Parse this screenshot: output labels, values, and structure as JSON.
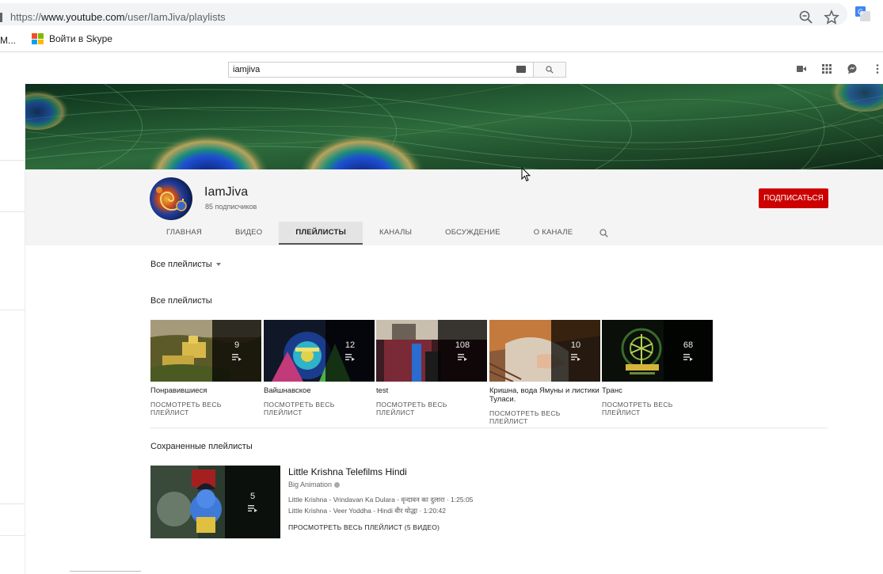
{
  "browser": {
    "url_prefix": "https://",
    "url_domain": "www.youtube.com",
    "url_path": "/user/IamJiva/playlists",
    "bookmark_first": "M...",
    "bookmark_skype": "Войти в Skype"
  },
  "search": {
    "value": "iamjiva"
  },
  "channel": {
    "name": "IamJiva",
    "subscribers": "85 подписчиков",
    "subscribe_label": "ПОДПИСАТЬСЯ"
  },
  "tabs": [
    {
      "label": "ГЛАВНАЯ"
    },
    {
      "label": "ВИДЕО"
    },
    {
      "label": "ПЛЕЙЛИСТЫ"
    },
    {
      "label": "КАНАЛЫ"
    },
    {
      "label": "ОБСУЖДЕНИЕ"
    },
    {
      "label": "О КАНАЛЕ"
    }
  ],
  "filter": {
    "label": "Все плейлисты"
  },
  "all_playlists": {
    "title": "Все плейлисты",
    "items": [
      {
        "title": "Понравившиеся",
        "count": "9",
        "link": "ПОСМОТРЕТЬ ВЕСЬ ПЛЕЙЛИСТ"
      },
      {
        "title": "Вайшнавское",
        "count": "12",
        "link": "ПОСМОТРЕТЬ ВЕСЬ ПЛЕЙЛИСТ"
      },
      {
        "title": "test",
        "count": "108",
        "link": "ПОСМОТРЕТЬ ВЕСЬ ПЛЕЙЛИСТ"
      },
      {
        "title": "Кришна, вода Ямуны и листики Туласи.",
        "count": "10",
        "link": "ПОСМОТРЕТЬ ВЕСЬ ПЛЕЙЛИСТ"
      },
      {
        "title": "Транс",
        "count": "68",
        "link": "ПОСМОТРЕТЬ ВЕСЬ ПЛЕЙЛИСТ"
      }
    ]
  },
  "saved_playlists": {
    "title": "Сохраненные плейлисты",
    "item": {
      "title": "Little Krishna Telefilms Hindi",
      "author": "Big Animation",
      "count": "5",
      "videos": [
        "Little Krishna - Vrindavan Ka Dulara - वृन्दावन का दुलारा · 1:25:05",
        "Little Krishna - Veer Yoddha - Hindi वीर योद्धा · 1:20:42"
      ],
      "link": "ПРОСМОТРЕТЬ ВЕСЬ ПЛЕЙЛИСТ (5 ВИДЕО)"
    }
  },
  "colors": {
    "subscribe_red": "#cc0000",
    "header_bg": "#f4f4f4",
    "banner_green": "#0f3b20"
  }
}
